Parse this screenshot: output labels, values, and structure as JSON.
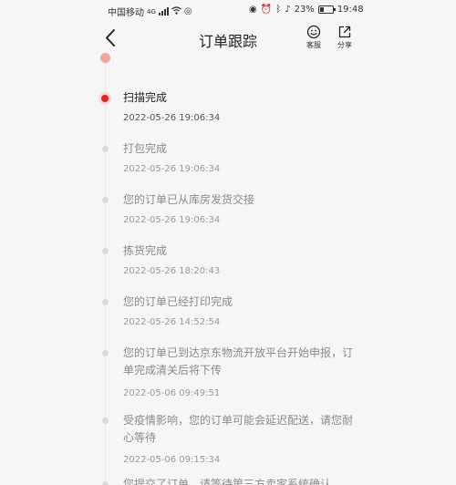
{
  "status_bar": {
    "carrier": "中国移动",
    "network": "4G",
    "wifi_icon": "wifi-icon",
    "battery": "23%",
    "time": "19:48"
  },
  "header": {
    "title": "订单跟踪",
    "service_label": "客服",
    "share_label": "分享",
    "back_icon": "chevron-left-icon",
    "service_icon": "smiley-icon",
    "share_icon": "share-icon"
  },
  "colors": {
    "accent": "#e8231e",
    "background": "#f6f6f6"
  },
  "events": [
    {
      "title": "扫描完成",
      "time": "2022-05-26 19:06:34",
      "active": true
    },
    {
      "title": "打包完成",
      "time": "2022-05-26 19:06:34",
      "active": false
    },
    {
      "title": "您的订单已从库房发货交接",
      "time": "2022-05-26 19:06:34",
      "active": false
    },
    {
      "title": "拣货完成",
      "time": "2022-05-26 18:20:43",
      "active": false
    },
    {
      "title": "您的订单已经打印完成",
      "time": "2022-05-26 14:52:54",
      "active": false
    },
    {
      "title": "您的订单已到达京东物流开放平台开始申报，订单完成清关后将下传",
      "time": "2022-05-06 09:49:51",
      "active": false
    },
    {
      "title": "受疫情影响，您的订单可能会延迟配送，请您耐心等待",
      "time": "2022-05-06 09:15:34",
      "active": false
    },
    {
      "title": "您提交了订单，请等待第三方卖家系统确认",
      "time": "",
      "active": false
    }
  ]
}
